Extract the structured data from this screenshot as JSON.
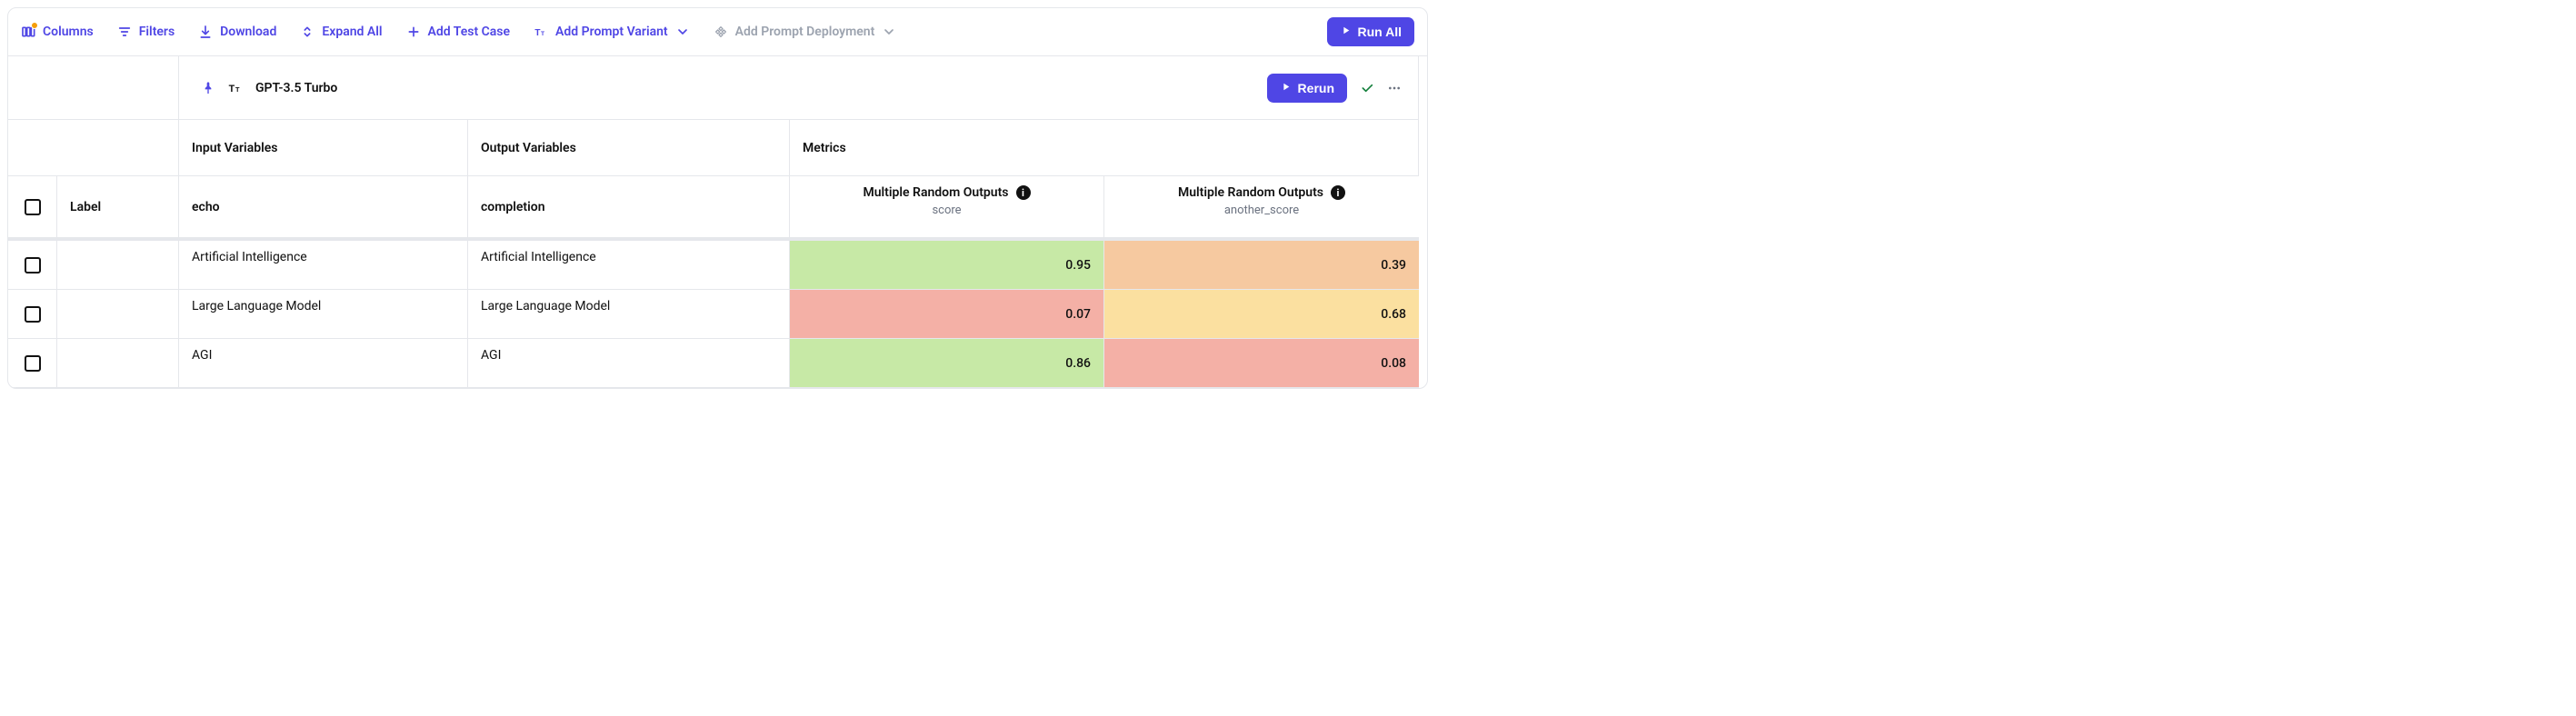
{
  "toolbar": {
    "columns": "Columns",
    "filters": "Filters",
    "download": "Download",
    "expand_all": "Expand All",
    "add_test_case": "Add Test Case",
    "add_prompt_variant": "Add Prompt Variant",
    "add_prompt_deployment": "Add Prompt Deployment",
    "run_all": "Run All"
  },
  "variant": {
    "name": "GPT-3.5 Turbo",
    "rerun": "Rerun"
  },
  "sections": {
    "input": "Input Variables",
    "output": "Output Variables",
    "metrics": "Metrics"
  },
  "columns": {
    "label": "Label",
    "echo": "echo",
    "completion": "completion",
    "metric1_title": "Multiple Random Outputs",
    "metric1_sub": "score",
    "metric2_title": "Multiple Random Outputs",
    "metric2_sub": "another_score"
  },
  "rows": [
    {
      "echo": "Artificial Intelligence",
      "completion": "Artificial Intelligence",
      "score": "0.95",
      "score_class": "bg-green-light",
      "another": "0.39",
      "another_class": "bg-orange-light"
    },
    {
      "echo": "Large Language Model",
      "completion": "Large Language Model",
      "score": "0.07",
      "score_class": "bg-red-light",
      "another": "0.68",
      "another_class": "bg-yellow-light"
    },
    {
      "echo": "AGI",
      "completion": "AGI",
      "score": "0.86",
      "score_class": "bg-green-light",
      "another": "0.08",
      "another_class": "bg-red-light"
    }
  ]
}
